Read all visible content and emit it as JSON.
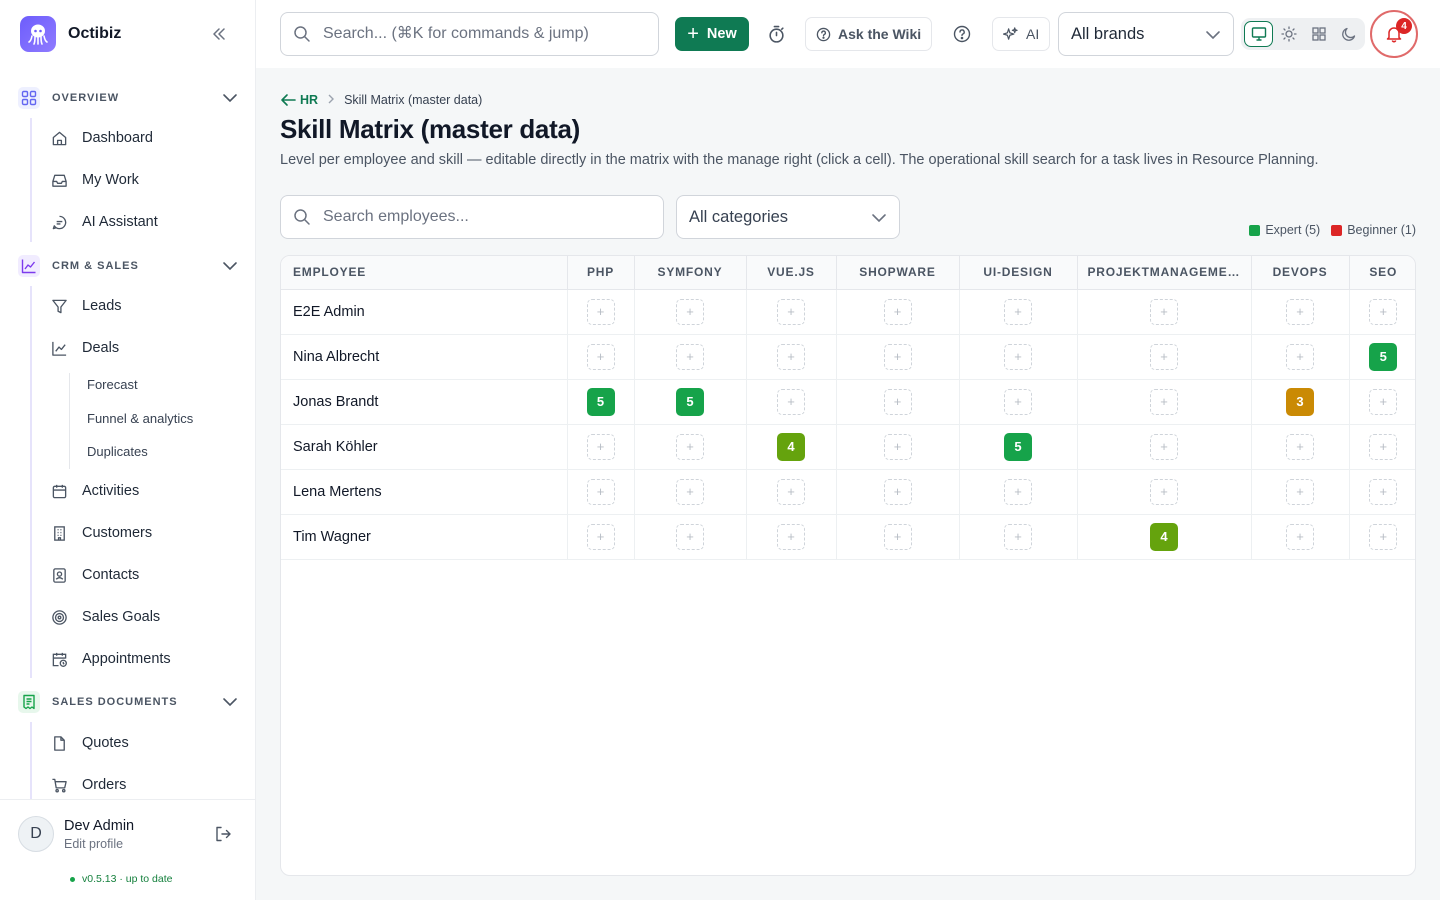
{
  "app": {
    "name": "Octibiz"
  },
  "sidebar": {
    "sections": [
      {
        "label": "OVERVIEW",
        "items": [
          {
            "label": "Dashboard",
            "icon": "home-icon"
          },
          {
            "label": "My Work",
            "icon": "inbox-icon"
          },
          {
            "label": "AI Assistant",
            "icon": "chat-icon"
          }
        ]
      },
      {
        "label": "CRM & SALES",
        "items": [
          {
            "label": "Leads",
            "icon": "filter-icon"
          },
          {
            "label": "Deals",
            "icon": "trend-icon"
          },
          {
            "label": "Activities",
            "icon": "calendar-icon"
          },
          {
            "label": "Customers",
            "icon": "building-icon"
          },
          {
            "label": "Contacts",
            "icon": "contact-icon"
          },
          {
            "label": "Sales Goals",
            "icon": "target-icon"
          },
          {
            "label": "Appointments",
            "icon": "calendar-clock-icon"
          }
        ],
        "deal_subitems": [
          "Forecast",
          "Funnel & analytics",
          "Duplicates"
        ]
      },
      {
        "label": "SALES DOCUMENTS",
        "items": [
          {
            "label": "Quotes",
            "icon": "file-icon"
          },
          {
            "label": "Orders",
            "icon": "cart-icon"
          }
        ]
      }
    ],
    "user": {
      "initial": "D",
      "name": "Dev Admin",
      "sub": "Edit profile"
    },
    "version": "v0.5.13 · up to date"
  },
  "topbar": {
    "search_placeholder": "Search... (⌘K for commands & jump)",
    "new_label": "New",
    "wiki_label": "Ask the Wiki",
    "ai_label": "AI",
    "brand_select": "All brands",
    "notification_count": "4"
  },
  "breadcrumb": {
    "parent": "HR",
    "current": "Skill Matrix (master data)"
  },
  "page": {
    "title": "Skill Matrix (master data)",
    "description": "Level per employee and skill — editable directly in the matrix with the manage right (click a cell). The operational skill search for a task lives in Resource Planning."
  },
  "filters": {
    "employee_search_placeholder": "Search employees...",
    "category_select": "All categories"
  },
  "legend": [
    {
      "label": "Expert (5)",
      "color": "#16a34a"
    },
    {
      "label": "Beginner (1)",
      "color": "#dc2626"
    }
  ],
  "matrix": {
    "employee_header": "EMPLOYEE",
    "skills": [
      "PHP",
      "SYMFONY",
      "VUE.JS",
      "SHOPWARE",
      "UI-DESIGN",
      "PROJEKTMANAGEMENT",
      "DEVOPS",
      "SEO"
    ],
    "empty_symbol": "+",
    "level_colors": {
      "5": "#16a34a",
      "4": "#65a30d",
      "3": "#ca8a04",
      "2": "#ea580c",
      "1": "#dc2626"
    },
    "rows": [
      {
        "employee": "E2E Admin",
        "levels": [
          null,
          null,
          null,
          null,
          null,
          null,
          null,
          null
        ]
      },
      {
        "employee": "Nina Albrecht",
        "levels": [
          null,
          null,
          null,
          null,
          null,
          null,
          null,
          5
        ]
      },
      {
        "employee": "Jonas Brandt",
        "levels": [
          5,
          5,
          null,
          null,
          null,
          null,
          3,
          null
        ]
      },
      {
        "employee": "Sarah Köhler",
        "levels": [
          null,
          null,
          4,
          null,
          5,
          null,
          null,
          null
        ]
      },
      {
        "employee": "Lena Mertens",
        "levels": [
          null,
          null,
          null,
          null,
          null,
          null,
          null,
          null
        ]
      },
      {
        "employee": "Tim Wagner",
        "levels": [
          null,
          null,
          null,
          null,
          null,
          4,
          null,
          null
        ]
      }
    ]
  }
}
